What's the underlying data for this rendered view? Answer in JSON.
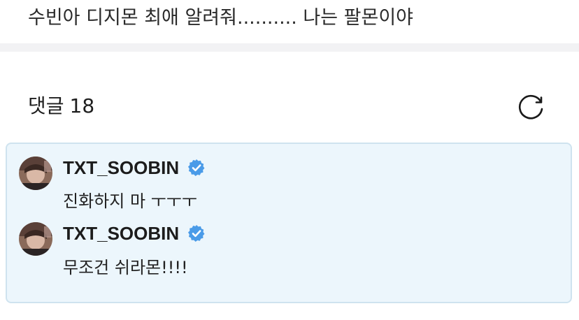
{
  "post": {
    "text": "수빈아 디지몬 최애 알려줘.......... 나는 팔몬이야"
  },
  "comments": {
    "label": "댓글",
    "count": "18",
    "refresh_icon": "refresh-icon"
  },
  "replies": [
    {
      "author": "TXT_SOOBIN",
      "verified_icon": "verified-badge-icon",
      "text": "진화하지 마 ㅜㅜㅜ"
    },
    {
      "author": "TXT_SOOBIN",
      "verified_icon": "verified-badge-icon",
      "text": "무조건 쉬라몬!!!!"
    }
  ],
  "colors": {
    "reply_bg": "#ecf6fc",
    "reply_border": "#cfe3ef",
    "verified_blue": "#4a9be8",
    "divider": "#f2f2f4"
  }
}
